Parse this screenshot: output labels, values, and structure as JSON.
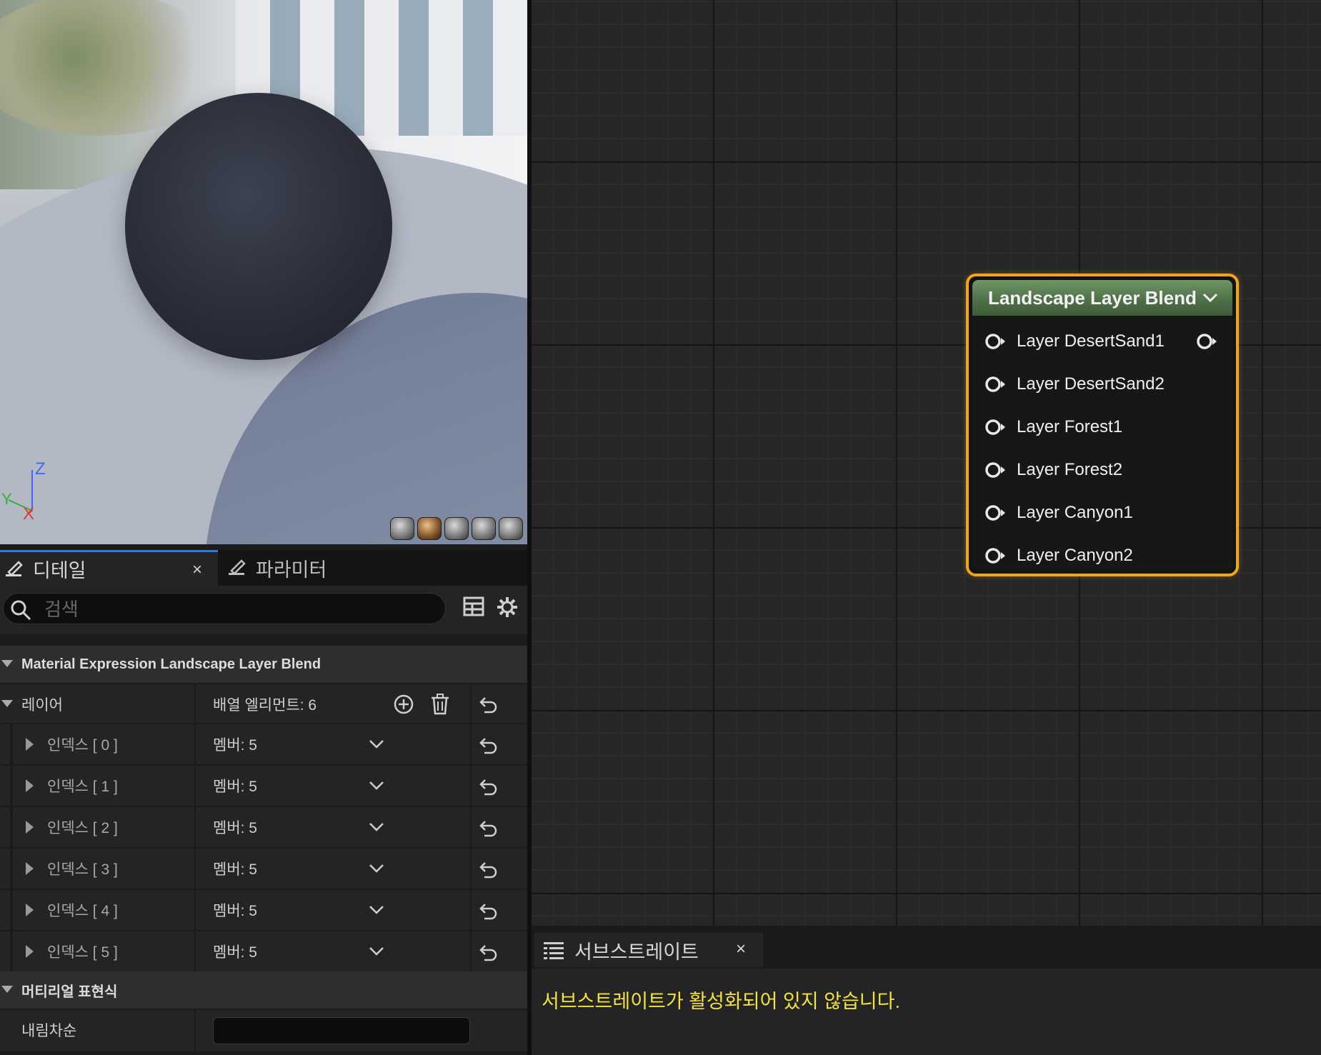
{
  "viewport": {
    "axis_labels": {
      "z": "Z",
      "y": "Y",
      "x": "X"
    },
    "preview_shapes": [
      "cylinder-icon",
      "sphere-icon",
      "plane-icon",
      "cube-icon",
      "custom-mesh-icon"
    ],
    "selected_shape": "sphere-icon"
  },
  "details_tabs": {
    "active": {
      "label": "디테일",
      "icon": "pencil-icon",
      "close": "×"
    },
    "inactive": {
      "label": "파라미터",
      "icon": "pencil-icon"
    }
  },
  "search": {
    "placeholder": "검색",
    "value": ""
  },
  "details": {
    "category1": "Material Expression Landscape Layer Blend",
    "layers": {
      "label": "레이어",
      "value": "배열 엘리먼트: 6"
    },
    "indices": [
      {
        "label": "인덱스 [ 0 ]",
        "value": "멤버: 5"
      },
      {
        "label": "인덱스 [ 1 ]",
        "value": "멤버: 5"
      },
      {
        "label": "인덱스 [ 2 ]",
        "value": "멤버: 5"
      },
      {
        "label": "인덱스 [ 3 ]",
        "value": "멤버: 5"
      },
      {
        "label": "인덱스 [ 4 ]",
        "value": "멤버: 5"
      },
      {
        "label": "인덱스 [ 5 ]",
        "value": "멤버: 5"
      }
    ],
    "category2": "머티리얼 표현식",
    "desc": {
      "label": "내림차순",
      "value": ""
    }
  },
  "node": {
    "title": "Landscape Layer Blend",
    "pins": [
      "Layer DesertSand1",
      "Layer DesertSand2",
      "Layer Forest1",
      "Layer Forest2",
      "Layer Canyon1",
      "Layer Canyon2"
    ],
    "accent_color": "#f0a51b",
    "header_color": "#5a8051"
  },
  "substrate": {
    "tab_label": "서브스트레이트",
    "close": "×",
    "message": "서브스트레이트가 활성화되어 있지 않습니다.",
    "message_color": "#f2e23a"
  }
}
